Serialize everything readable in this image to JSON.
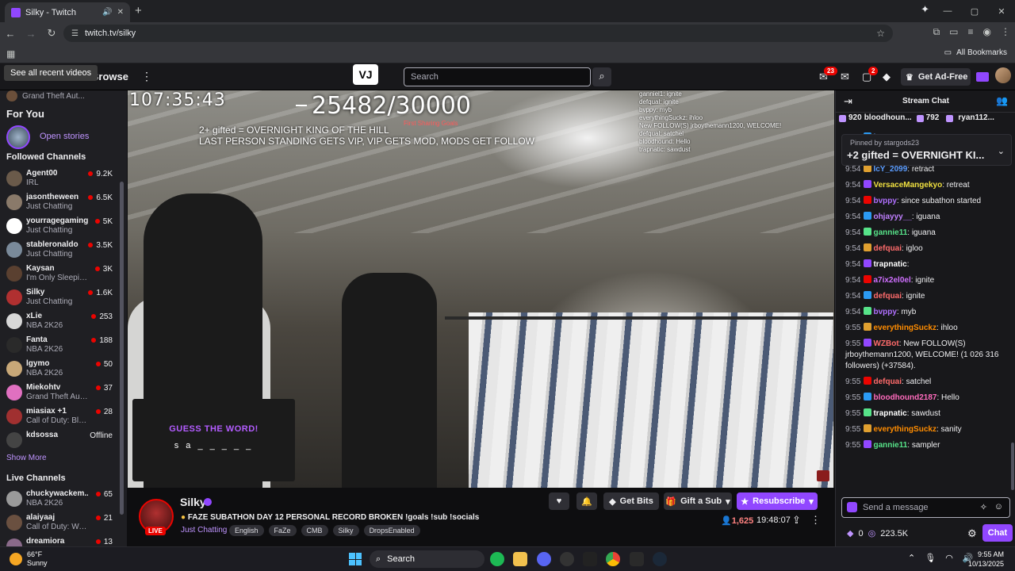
{
  "browser": {
    "tab_title": "Silky - Twitch",
    "url": "twitch.tv/silky",
    "all_bookmarks": "All Bookmarks",
    "tooltip": "See all recent videos"
  },
  "topnav": {
    "browse": "Browse",
    "search_placeholder": "Search",
    "notif_count": "23",
    "whisper_count": "2",
    "ad_free": "Get Ad-Free"
  },
  "sidebar": {
    "previous_game": "Grand Theft Aut...",
    "for_you": "For You",
    "open_stories": "Open stories",
    "followed_heading": "Followed Channels",
    "followed": [
      {
        "name": "Agent00",
        "game": "IRL",
        "viewers": "9.2K",
        "color": "#6a5a4a"
      },
      {
        "name": "jasontheween",
        "game": "Just Chatting",
        "viewers": "6.5K",
        "color": "#8a7a6a"
      },
      {
        "name": "yourragegaming",
        "game": "Just Chatting",
        "viewers": "5K",
        "color": "#ffffff"
      },
      {
        "name": "stableronaldo",
        "game": "Just Chatting",
        "viewers": "3.5K",
        "color": "#7a8a9a"
      },
      {
        "name": "Kaysan",
        "game": "I'm Only Sleeping",
        "viewers": "3K",
        "color": "#5a4030"
      },
      {
        "name": "Silky",
        "game": "Just Chatting",
        "viewers": "1.6K",
        "color": "#b03030"
      },
      {
        "name": "xLie",
        "game": "NBA 2K26",
        "viewers": "253",
        "color": "#d8d8d8"
      },
      {
        "name": "Fanta",
        "game": "NBA 2K26",
        "viewers": "188",
        "color": "#2a2a2a"
      },
      {
        "name": "lgymo",
        "game": "NBA 2K26",
        "viewers": "50",
        "color": "#c8a878"
      },
      {
        "name": "Miekohtv",
        "game": "Grand Theft Auto...",
        "viewers": "37",
        "color": "#e070c0"
      },
      {
        "name": "miasiax +1",
        "game": "Call of Duty: Bla...",
        "viewers": "28",
        "color": "#a03030"
      },
      {
        "name": "kdsossa",
        "game": "",
        "viewers": "Offline",
        "color": "#444444"
      }
    ],
    "show_more": "Show More",
    "live_heading": "Live Channels",
    "live": [
      {
        "name": "chuckywackem...",
        "game": "NBA 2K26",
        "viewers": "65",
        "color": "#9a9a9a"
      },
      {
        "name": "alaiyaaj",
        "game": "Call of Duty: Wa...",
        "viewers": "21",
        "color": "#6a5040"
      },
      {
        "name": "dreamiora",
        "game": "",
        "viewers": "13",
        "color": "#8a6a8a"
      }
    ]
  },
  "video": {
    "overlay_time": "107:35:43",
    "goal": "25482/30000",
    "goal_sub": "First Sharing Goals",
    "line1": "2+ gifted = OVERNIGHT KING OF THE HILL",
    "line2": "LAST PERSON STANDING GETS VIP, VIP GETS MOD, MODS GET FOLLOW",
    "overlay_chat": [
      "ganniel1: ignite",
      "defqual: ignite",
      "bvppy: myb",
      "everythingSuckz: ihloo",
      "New FOLLOW(S) jrboythemann1200, WELCOME!",
      "defqual: satchel",
      "bloodhound: Hello",
      "trapnatic: sawdust"
    ],
    "game_title": "GUESS THE WORD!",
    "game_word": "s a _ _ _ _ _"
  },
  "stream": {
    "channel": "Silky",
    "live": "LIVE",
    "title": "FAZE SUBATHON DAY 12 PERSONAL RECORD BROKEN !goals !sub !socials",
    "category": "Just Chatting",
    "tags": [
      "English",
      "FaZe",
      "CMB",
      "Silky",
      "DropsEnabled"
    ],
    "get_bits": "Get Bits",
    "gift_sub": "Gift a Sub",
    "resubscribe": "Resubscribe",
    "viewers": "1,625",
    "uptime": "19:48:07"
  },
  "chat": {
    "title": "Stream Chat",
    "gifters": [
      {
        "count": "920",
        "name": "bloodhoun..."
      },
      {
        "count": "792",
        "name": ""
      },
      {
        "count": "",
        "name": "ryan112..."
      }
    ],
    "pinned_by": "Pinned by stargods23",
    "pinned_msg": "+2 gifted = OVERNIGHT KI...",
    "messages": [
      {
        "time": "9:54",
        "user": "lcY_2099",
        "text": ": retreat",
        "color": "#5c9dff"
      },
      {
        "time": "9:54",
        "user": "gannie11",
        "text": ": retreat",
        "color": "#57e389"
      },
      {
        "time": "9:54",
        "user": "IcY_2099",
        "text": ": retract",
        "color": "#5c9dff"
      },
      {
        "time": "9:54",
        "user": "VersaceMangekyo",
        "text": ": retreat",
        "color": "#f0e040"
      },
      {
        "time": "9:54",
        "user": "bvppy",
        "text": ": since subathon started",
        "color": "#b070ff"
      },
      {
        "time": "9:54",
        "user": "ohjayyy__",
        "text": ": iguana",
        "color": "#c080ff"
      },
      {
        "time": "9:54",
        "user": "gannie11",
        "text": ": iguana",
        "color": "#57e389"
      },
      {
        "time": "9:54",
        "user": "defquai",
        "text": ": igloo",
        "color": "#ff6b6b"
      },
      {
        "time": "9:54",
        "user": "trapnatic",
        "text": ":",
        "color": "#ffffff"
      },
      {
        "time": "9:54",
        "user": "a7ix2el0el",
        "text": ": ignite",
        "color": "#d070ff"
      },
      {
        "time": "9:54",
        "user": "defquai",
        "text": ": ignite",
        "color": "#ff6b6b"
      },
      {
        "time": "9:54",
        "user": "bvppy",
        "text": ": myb",
        "color": "#b070ff"
      },
      {
        "time": "9:55",
        "user": "everythingSuckz",
        "text": ": ihloo",
        "color": "#ff8c00"
      },
      {
        "time": "9:55",
        "user": "WZBot",
        "text": ": New FOLLOW(S) jrboythemann1200, WELCOME! (1 026 316 followers) (+37584).",
        "color": "#ff6b6b"
      },
      {
        "time": "9:55",
        "user": "defquai",
        "text": ": satchel",
        "color": "#ff6b6b"
      },
      {
        "time": "9:55",
        "user": "bloodhound2187",
        "text": ": Hello",
        "color": "#ff6bbd"
      },
      {
        "time": "9:55",
        "user": "trapnatic",
        "text": ": sawdust",
        "color": "#ffffff"
      },
      {
        "time": "9:55",
        "user": "everythingSuckz",
        "text": ": sanity",
        "color": "#ff8c00"
      },
      {
        "time": "9:55",
        "user": "gannie11",
        "text": ": sampler",
        "color": "#57e389"
      }
    ],
    "input_placeholder": "Send a message",
    "points_left": "0",
    "points": "223.5K",
    "chat_button": "Chat"
  },
  "taskbar": {
    "temp": "66°F",
    "weather": "Sunny",
    "search": "Search",
    "time": "9:55 AM",
    "date": "10/13/2025"
  }
}
